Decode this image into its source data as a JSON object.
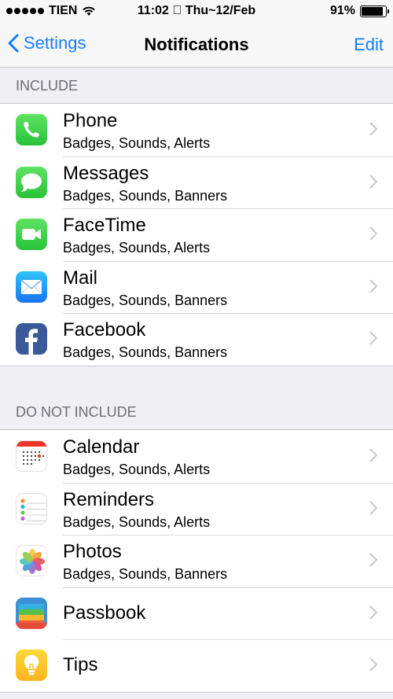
{
  "status_bar": {
    "carrier": "TIEN",
    "time_date": "11:02  Thu~12/Feb",
    "battery_percent": "91%",
    "battery_level": 0.91
  },
  "nav": {
    "back_label": "Settings",
    "title": "Notifications",
    "edit_label": "Edit"
  },
  "include": {
    "header": "INCLUDE",
    "items": [
      {
        "icon": "phone-icon",
        "title": "Phone",
        "subtitle": "Badges, Sounds, Alerts"
      },
      {
        "icon": "messages-icon",
        "title": "Messages",
        "subtitle": "Badges, Sounds, Banners"
      },
      {
        "icon": "facetime-icon",
        "title": "FaceTime",
        "subtitle": "Badges, Sounds, Alerts"
      },
      {
        "icon": "mail-icon",
        "title": "Mail",
        "subtitle": "Badges, Sounds, Banners"
      },
      {
        "icon": "facebook-icon",
        "title": "Facebook",
        "subtitle": "Badges, Sounds, Banners"
      }
    ]
  },
  "do_not_include": {
    "header": "DO NOT INCLUDE",
    "items": [
      {
        "icon": "calendar-icon",
        "title": "Calendar",
        "subtitle": "Badges, Sounds, Alerts"
      },
      {
        "icon": "reminders-icon",
        "title": "Reminders",
        "subtitle": "Badges, Sounds, Alerts"
      },
      {
        "icon": "photos-icon",
        "title": "Photos",
        "subtitle": "Badges, Sounds, Banners"
      },
      {
        "icon": "passbook-icon",
        "title": "Passbook",
        "subtitle": ""
      },
      {
        "icon": "tips-icon",
        "title": "Tips",
        "subtitle": ""
      }
    ]
  },
  "colors": {
    "accent": "#157efb",
    "background": "#efeff4"
  }
}
